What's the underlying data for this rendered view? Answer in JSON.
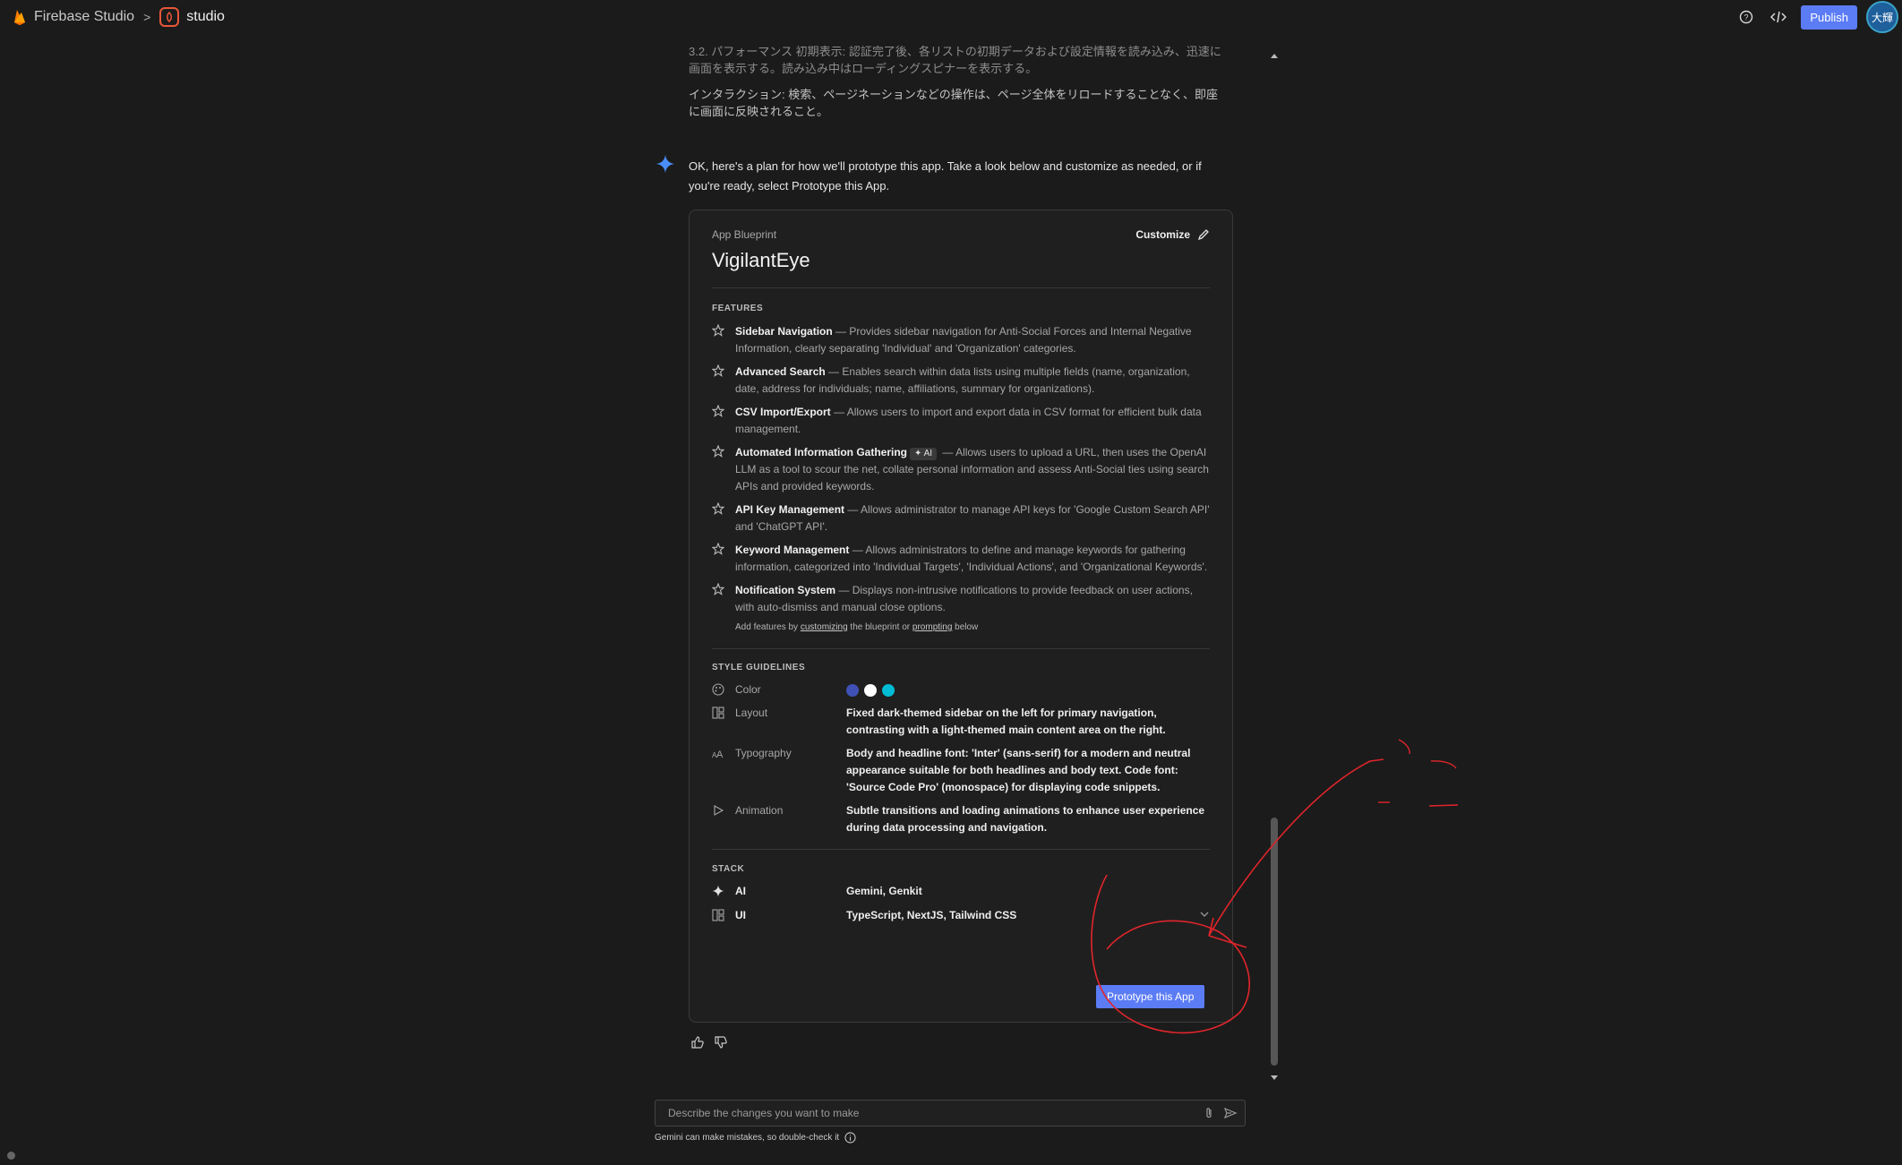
{
  "header": {
    "brand": "Firebase Studio",
    "separator": ">",
    "workspace": "studio",
    "publish_label": "Publish",
    "avatar_text": "大輝"
  },
  "chat": {
    "partial_para": "3.2. パフォーマンス 初期表示: 認証完了後、各リストの初期データおよび設定情報を読み込み、迅速に画面を表示する。読み込み中はローディングスピナーを表示する。",
    "interaction_para": "インタラクション: 検索、ページネーションなどの操作は、ページ全体をリロードすることなく、即座に画面に反映されること。",
    "gemini_intro": "OK, here's a plan for how we'll prototype this app. Take a look below and customize as needed, or if you're ready, select Prototype this App."
  },
  "blueprint": {
    "label": "App Blueprint",
    "title": "VigilantEye",
    "customize_label": "Customize",
    "features_heading": "FEATURES",
    "features": [
      {
        "name": "Sidebar Navigation",
        "desc": " — Provides sidebar navigation for Anti-Social Forces and Internal Negative Information, clearly separating 'Individual' and 'Organization' categories."
      },
      {
        "name": "Advanced Search",
        "desc": " — Enables search within data lists using multiple fields (name, organization, date, address for individuals; name, affiliations, summary for organizations)."
      },
      {
        "name": "CSV Import/Export",
        "desc": " — Allows users to import and export data in CSV format for efficient bulk data management."
      },
      {
        "name": "Automated Information Gathering",
        "badge": "✦ AI",
        "desc": " — Allows users to upload a URL, then uses the OpenAI LLM as a tool to scour the net, collate personal information and assess Anti-Social ties using search APIs and provided keywords."
      },
      {
        "name": "API Key Management",
        "desc": " — Allows administrator to manage API keys for 'Google Custom Search API' and 'ChatGPT API'."
      },
      {
        "name": "Keyword Management",
        "desc": " — Allows administrators to define and manage keywords for gathering information, categorized into 'Individual Targets', 'Individual Actions', and 'Organizational Keywords'."
      },
      {
        "name": "Notification System",
        "desc": " — Displays non-intrusive notifications to provide feedback on user actions, with auto-dismiss and manual close options."
      }
    ],
    "add_features": {
      "pre": "Add features by ",
      "link1": "customizing",
      "mid": " the blueprint or ",
      "link2": "prompting",
      "post": " below"
    },
    "style_heading": "STYLE GUIDELINES",
    "style": {
      "color_label": "Color",
      "colors": [
        "#3f51b5",
        "#ffffff",
        "#00bcd4"
      ],
      "layout_label": "Layout",
      "layout_value": "Fixed dark-themed sidebar on the left for primary navigation, contrasting with a light-themed main content area on the right.",
      "typography_label": "Typography",
      "typography_value": "Body and headline font: 'Inter' (sans-serif) for a modern and neutral appearance suitable for both headlines and body text. Code font: 'Source Code Pro' (monospace) for displaying code snippets.",
      "animation_label": "Animation",
      "animation_value": "Subtle transitions and loading animations to enhance user experience during data processing and navigation."
    },
    "stack_heading": "STACK",
    "stack": [
      {
        "label": "AI",
        "value": "Gemini, Genkit"
      },
      {
        "label": "UI",
        "value": "TypeScript, NextJS, Tailwind CSS"
      }
    ],
    "prototype_label": "Prototype this App"
  },
  "input": {
    "placeholder": "Describe the changes you want to make",
    "disclaimer": "Gemini can make mistakes, so double-check it"
  },
  "colors": {
    "accent": "#5b7cf5",
    "annotation": "#e0252b",
    "background": "#1b1b1b"
  }
}
